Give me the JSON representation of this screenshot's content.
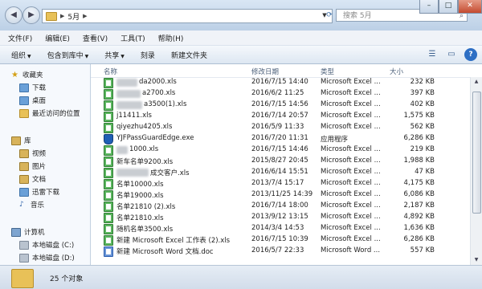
{
  "address": {
    "crumb": "5月",
    "search_placeholder": "搜索 5月"
  },
  "menu": [
    "文件(F)",
    "编辑(E)",
    "查看(V)",
    "工具(T)",
    "帮助(H)"
  ],
  "toolbar": {
    "organize": "组织",
    "include": "包含到库中",
    "share": "共享",
    "burn": "刻录",
    "new_folder": "新建文件夹"
  },
  "nav": {
    "favorites": "收藏夹",
    "downloads": "下载",
    "desktop": "桌面",
    "recent": "最近访问的位置",
    "libraries": "库",
    "videos": "视频",
    "pictures": "图片",
    "documents": "文档",
    "thunder": "迅雷下载",
    "music": "音乐",
    "computer": "计算机",
    "drive_c": "本地磁盘 (C:)",
    "drive_d": "本地磁盘 (D:)"
  },
  "columns": {
    "name": "名称",
    "date": "修改日期",
    "type": "类型",
    "size": "大小"
  },
  "files": [
    {
      "name": "da2000.xls",
      "date": "2016/7/15 14:40",
      "type": "Microsoft Excel ...",
      "size": "232 KB",
      "icon": "xls"
    },
    {
      "name": "a2700.xls",
      "date": "2016/6/2 11:25",
      "type": "Microsoft Excel ...",
      "size": "397 KB",
      "icon": "xls"
    },
    {
      "name": "a3500(1).xls",
      "date": "2016/7/15 14:56",
      "type": "Microsoft Excel ...",
      "size": "402 KB",
      "icon": "xls"
    },
    {
      "name": "j11411.xls",
      "date": "2016/7/14 20:57",
      "type": "Microsoft Excel ...",
      "size": "1,575 KB",
      "icon": "xls"
    },
    {
      "name": "qiyezhu4205.xls",
      "date": "2016/5/9 11:33",
      "type": "Microsoft Excel ...",
      "size": "562 KB",
      "icon": "xls"
    },
    {
      "name": "YJFPassGuardEdge.exe",
      "date": "2016/7/20 11:31",
      "type": "应用程序",
      "size": "6,286 KB",
      "icon": "exe"
    },
    {
      "name": "1000.xls",
      "date": "2016/7/15 14:46",
      "type": "Microsoft Excel ...",
      "size": "219 KB",
      "icon": "xls"
    },
    {
      "name": "新车名单9200.xls",
      "date": "2015/8/27 20:45",
      "type": "Microsoft Excel ...",
      "size": "1,988 KB",
      "icon": "xls"
    },
    {
      "name": "成交客户.xls",
      "date": "2016/6/14 15:51",
      "type": "Microsoft Excel ...",
      "size": "47 KB",
      "icon": "xls"
    },
    {
      "name": "名单10000.xls",
      "date": "2013/7/4 15:17",
      "type": "Microsoft Excel ...",
      "size": "4,175 KB",
      "icon": "xls"
    },
    {
      "name": "名单19000.xls",
      "date": "2013/11/25 14:39",
      "type": "Microsoft Excel ...",
      "size": "6,086 KB",
      "icon": "xls"
    },
    {
      "name": "名单21810 (2).xls",
      "date": "2016/7/14 18:00",
      "type": "Microsoft Excel ...",
      "size": "2,187 KB",
      "icon": "xls"
    },
    {
      "name": "名单21810.xls",
      "date": "2013/9/12 13:15",
      "type": "Microsoft Excel ...",
      "size": "4,892 KB",
      "icon": "xls"
    },
    {
      "name": "随机名单3500.xls",
      "date": "2014/3/4 14:53",
      "type": "Microsoft Excel ...",
      "size": "1,636 KB",
      "icon": "xls"
    },
    {
      "name": "新建 Microsoft Excel 工作表 (2).xls",
      "date": "2016/7/15 10:39",
      "type": "Microsoft Excel ...",
      "size": "6,286 KB",
      "icon": "xls"
    },
    {
      "name": "新建 Microsoft Word 文档.doc",
      "date": "2016/5/7 22:33",
      "type": "Microsoft Word ...",
      "size": "557 KB",
      "icon": "doc"
    }
  ],
  "status": {
    "count": "25 个对象"
  }
}
